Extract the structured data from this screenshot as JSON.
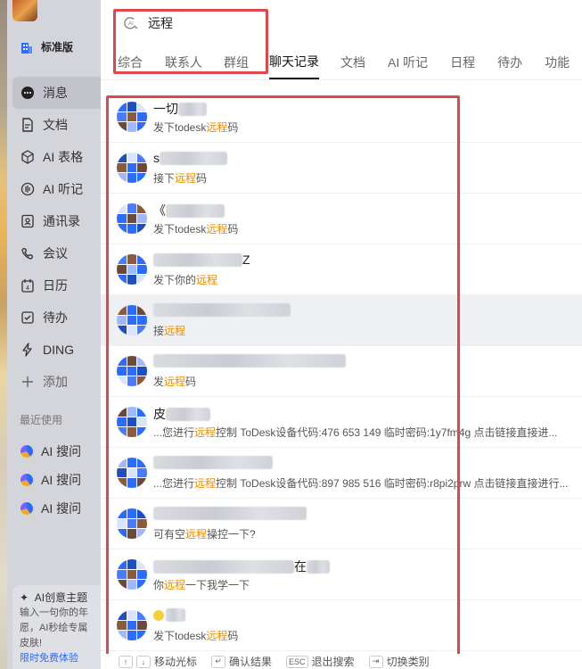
{
  "sidebar": {
    "edition_label": "标准版",
    "nav": [
      {
        "label": "消息",
        "icon": "message-icon",
        "active": true
      },
      {
        "label": "文档",
        "icon": "document-icon"
      },
      {
        "label": "AI 表格",
        "icon": "ai-table-icon"
      },
      {
        "label": "AI 听记",
        "icon": "ai-listen-icon"
      },
      {
        "label": "通讯录",
        "icon": "contacts-icon"
      },
      {
        "label": "会议",
        "icon": "meeting-icon"
      },
      {
        "label": "日历",
        "icon": "calendar-icon"
      },
      {
        "label": "待办",
        "icon": "todo-icon"
      },
      {
        "label": "DING",
        "icon": "ding-icon"
      },
      {
        "label": "添加",
        "icon": "plus-icon"
      }
    ],
    "recent_heading": "最近使用",
    "recent": [
      {
        "label": "AI 搜问"
      },
      {
        "label": "AI 搜问"
      },
      {
        "label": "AI 搜问"
      }
    ],
    "promo": {
      "title": "AI创意主题",
      "line1": "输入一句你的年",
      "line2": "愿，AI秒绘专属",
      "line3": "皮肤!",
      "link": "限时免费体验"
    }
  },
  "search": {
    "value": "远程"
  },
  "tabs": [
    "综合",
    "联系人",
    "群组",
    "聊天记录",
    "文档",
    "AI 听记",
    "日程",
    "待办",
    "功能"
  ],
  "active_tab": "聊天记录",
  "results": [
    {
      "title_prefix": "一切",
      "title_suffix": "",
      "sub_before": "发下todesk",
      "keyword": "远程",
      "sub_after": "码"
    },
    {
      "title_prefix": "s",
      "title_suffix": "",
      "sub_before": "接下",
      "keyword": "远程",
      "sub_after": "码"
    },
    {
      "title_prefix": "《",
      "title_suffix": "",
      "sub_before": "发下todesk",
      "keyword": "远程",
      "sub_after": "码"
    },
    {
      "title_prefix": "",
      "title_suffix": "Z",
      "sub_before": "发下你的",
      "keyword": "远程",
      "sub_after": ""
    },
    {
      "title_prefix": "",
      "title_suffix": "",
      "sub_before": "接",
      "keyword": "远程",
      "sub_after": ""
    },
    {
      "title_prefix": "",
      "title_suffix": "",
      "sub_before": "发",
      "keyword": "远程",
      "sub_after": "码"
    },
    {
      "title_prefix": "皮",
      "title_suffix": "",
      "sub_before": "...您进行",
      "keyword": "远程",
      "sub_after": "控制 ToDesk设备代码:476 653 149 临时密码:1y7fm4g 点击链接直接进..."
    },
    {
      "title_prefix": "",
      "title_suffix": "",
      "sub_before": "...您进行",
      "keyword": "远程",
      "sub_after": "控制 ToDesk设备代码:897 985 516 临时密码:r8pi2prw 点击链接直接进行..."
    },
    {
      "title_prefix": "",
      "title_suffix": "",
      "sub_before": "可有空",
      "keyword": "远程",
      "sub_after": "操控一下?"
    },
    {
      "title_prefix": "",
      "title_suffix": "在",
      "sub_before": "你",
      "keyword": "远程",
      "sub_after": "一下我学一下"
    },
    {
      "title_prefix": "",
      "title_suffix": "",
      "sub_before": "发下todesk",
      "keyword": "远程",
      "sub_after": "码"
    }
  ],
  "footer": {
    "move_label": "移动光标",
    "confirm_label": "确认结果",
    "esc_key": "ESC",
    "exit_label": "退出搜索",
    "switch_label": "切换类别"
  },
  "colors": {
    "highlight": "#f08a00",
    "annotation_red": "#e0474c",
    "link": "#2b6bff"
  }
}
